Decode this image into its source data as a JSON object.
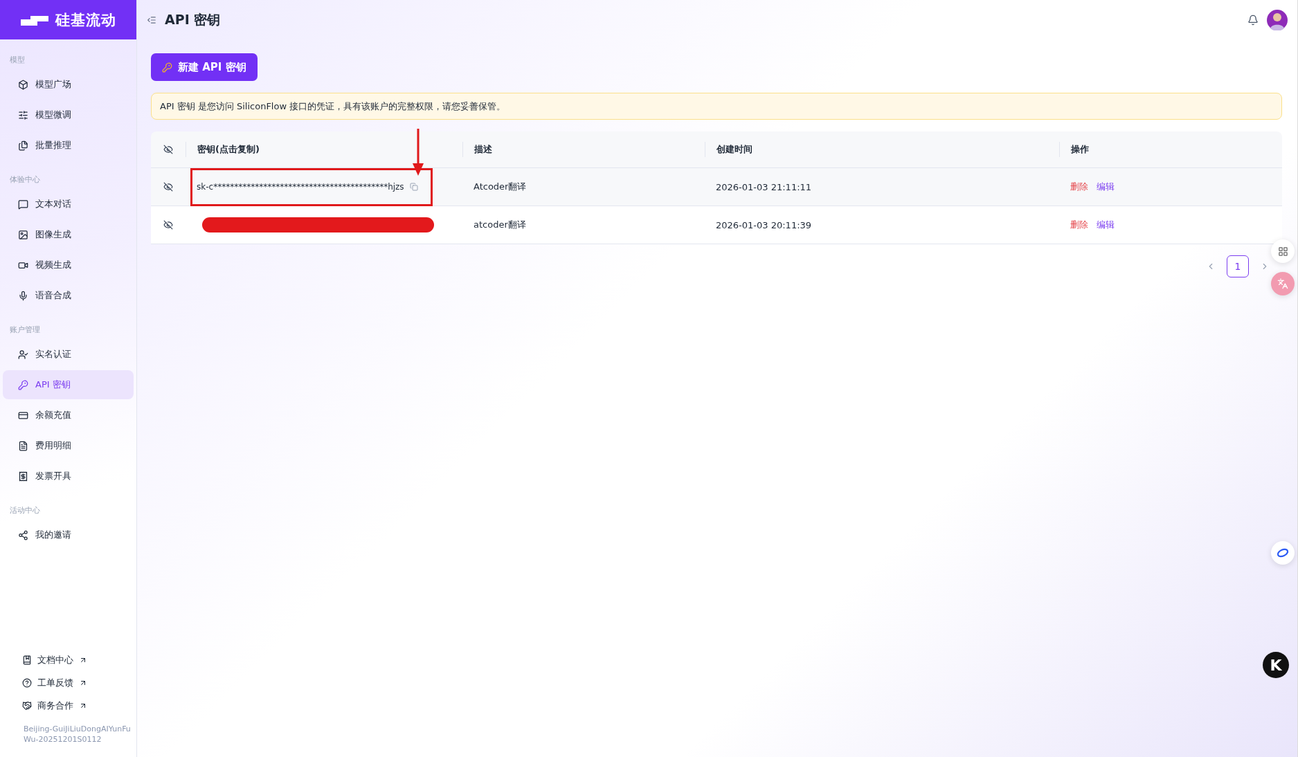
{
  "logo": {
    "text": "硅基流动"
  },
  "header": {
    "title": "API 密钥"
  },
  "sidebar": {
    "groups": [
      {
        "label": "模型",
        "items": [
          {
            "label": "模型广场",
            "selected": false
          },
          {
            "label": "模型微调",
            "selected": false
          },
          {
            "label": "批量推理",
            "selected": false
          }
        ]
      },
      {
        "label": "体验中心",
        "items": [
          {
            "label": "文本对话",
            "selected": false
          },
          {
            "label": "图像生成",
            "selected": false
          },
          {
            "label": "视频生成",
            "selected": false
          },
          {
            "label": "语音合成",
            "selected": false
          }
        ]
      },
      {
        "label": "账户管理",
        "items": [
          {
            "label": "实名认证",
            "selected": false
          },
          {
            "label": "API 密钥",
            "selected": true
          },
          {
            "label": "余额充值",
            "selected": false
          },
          {
            "label": "费用明细",
            "selected": false
          },
          {
            "label": "发票开具",
            "selected": false
          }
        ]
      },
      {
        "label": "活动中心",
        "items": [
          {
            "label": "我的邀请",
            "selected": false
          }
        ]
      }
    ],
    "links": [
      {
        "label": "文档中心"
      },
      {
        "label": "工单反馈"
      },
      {
        "label": "商务合作"
      }
    ],
    "footer": "Beijing-GuiJiLiuDongAIYunFuWu-20251201S0112"
  },
  "new_key_button": {
    "label": "新建 API 密钥"
  },
  "notice": "API 密钥 是您访问 SiliconFlow 接口的凭证，具有该账户的完整权限，请您妥善保管。",
  "table": {
    "columns": [
      "密钥(点击复制)",
      "描述",
      "创建时间",
      "操作"
    ],
    "rows": [
      {
        "key": "sk-c******************************************hjzs",
        "redacted": false,
        "highlighted": true,
        "description": "Atcoder翻译",
        "created": "2026-01-03 21:11:11",
        "actions": [
          "删除",
          "编辑"
        ]
      },
      {
        "redacted": true,
        "highlighted": false,
        "description": "atcoder翻译",
        "created": "2026-01-03 20:11:39",
        "actions": [
          "删除",
          "编辑"
        ]
      }
    ]
  },
  "pagination": {
    "pages": [
      {
        "label": "1",
        "selected": true
      }
    ]
  },
  "floating_badge": {
    "text": "K"
  }
}
